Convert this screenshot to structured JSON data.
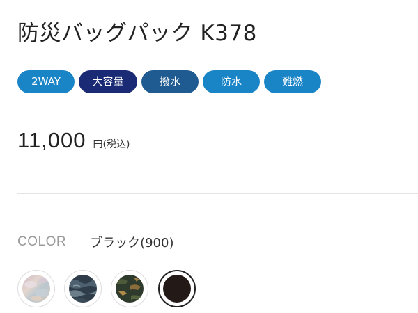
{
  "product": {
    "title": "防災バッグパック K378"
  },
  "tags": [
    {
      "label": "2WAY",
      "color": "#1a85c6",
      "width": 82
    },
    {
      "label": "大容量",
      "color": "#1a2a74",
      "width": 84
    },
    {
      "label": "撥水",
      "color": "#1f5a90",
      "width": 82
    },
    {
      "label": "防水",
      "color": "#1a85c6",
      "width": 82
    },
    {
      "label": "難燃",
      "color": "#1a85c6",
      "width": 82
    }
  ],
  "price": {
    "amount": "11,000",
    "unit": "円(税込)"
  },
  "color": {
    "label": "COLOR",
    "selected_value": "ブラック(900)",
    "swatches": [
      {
        "name": "swatch-light-pattern",
        "selected": false
      },
      {
        "name": "swatch-navy-camo",
        "selected": false
      },
      {
        "name": "swatch-green-camo",
        "selected": false
      },
      {
        "name": "swatch-black",
        "selected": true
      }
    ]
  }
}
